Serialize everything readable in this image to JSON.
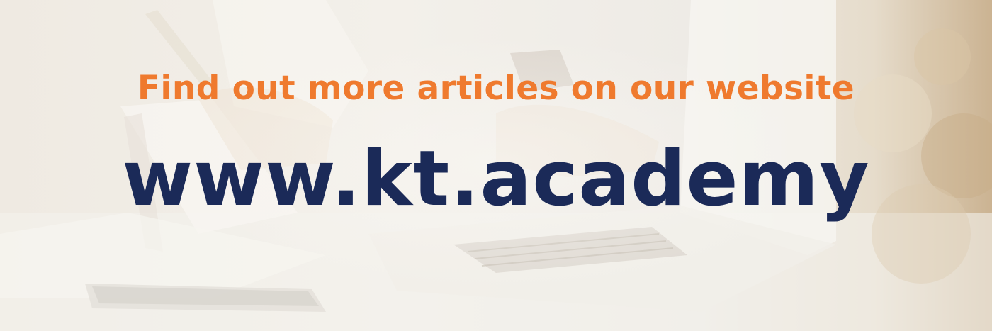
{
  "banner": {
    "headline": "Find out more articles on our website",
    "url": "www.kt.academy"
  },
  "colors": {
    "headline": "#ef7a2e",
    "url": "#1b2a58",
    "background": "#f2efe9"
  }
}
